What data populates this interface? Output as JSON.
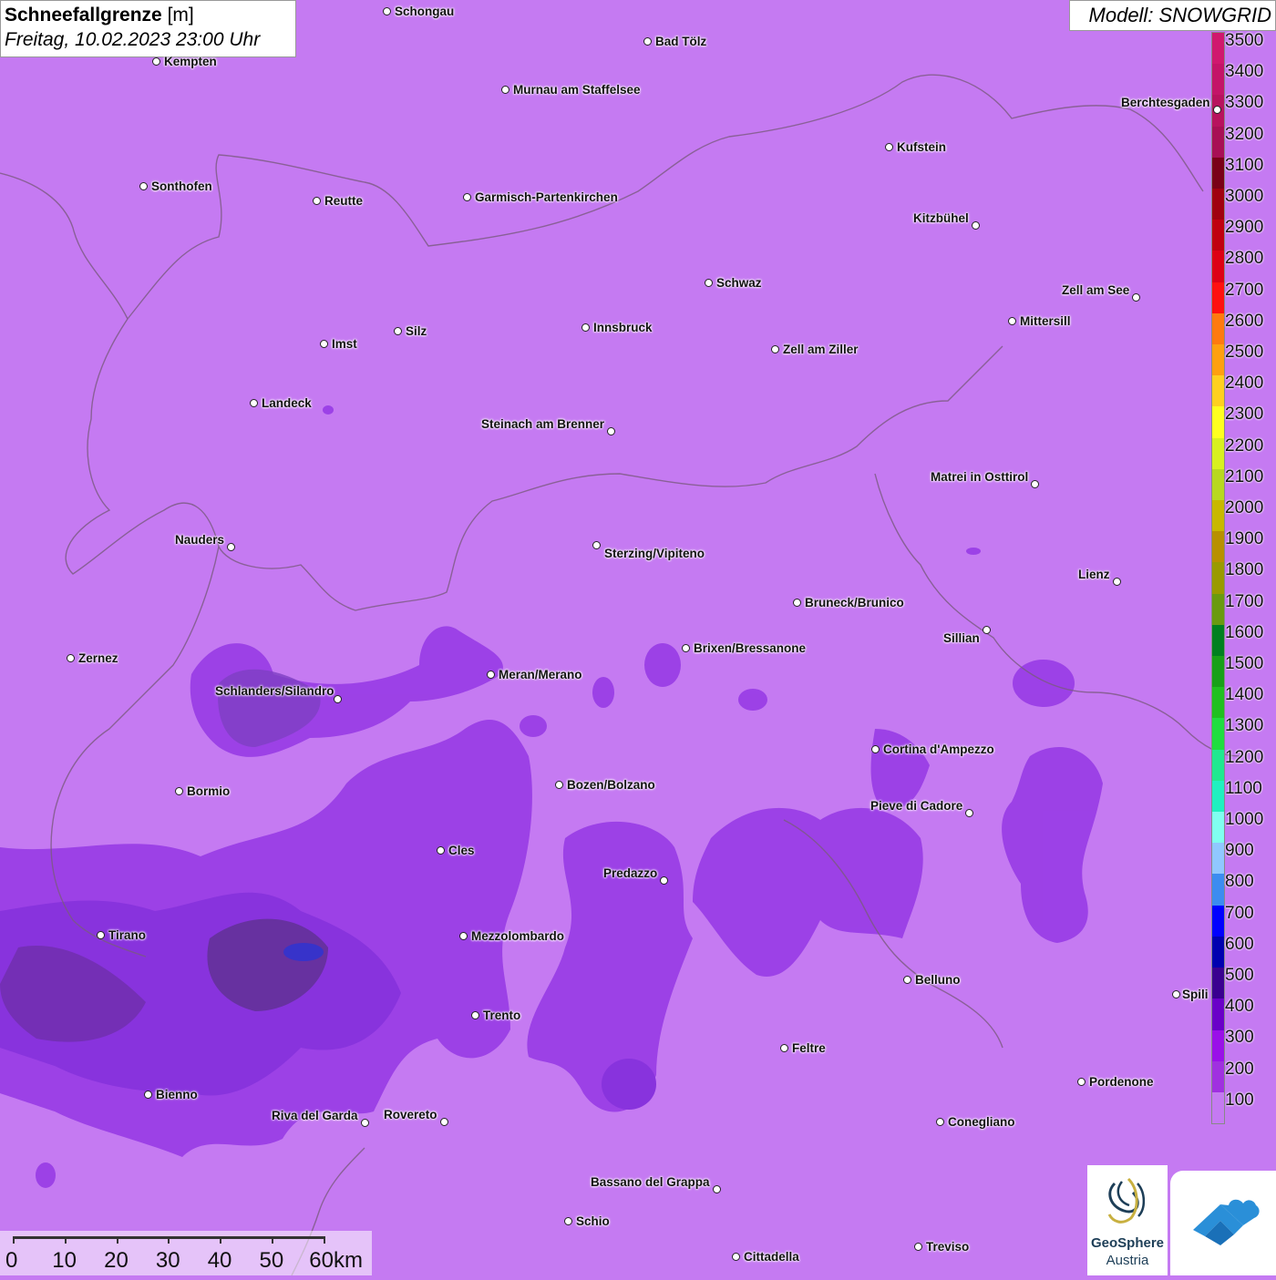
{
  "title": {
    "main": "Schneefallgrenze",
    "unit": "[m]",
    "datetime": "Freitag, 10.02.2023 23:00 Uhr"
  },
  "model": "Modell: SNOWGRID",
  "legend": {
    "labels": [
      "3500",
      "3400",
      "3300",
      "3200",
      "3100",
      "3000",
      "2900",
      "2800",
      "2700",
      "2600",
      "2500",
      "2400",
      "2300",
      "2200",
      "2100",
      "2000",
      "1900",
      "1800",
      "1700",
      "1600",
      "1500",
      "1400",
      "1300",
      "1200",
      "1100",
      "1000",
      "900",
      "800",
      "700",
      "600",
      "500",
      "400",
      "300",
      "200",
      "100"
    ],
    "colors": [
      "#d0186e",
      "#c41468",
      "#b8125e",
      "#a80f55",
      "#7a0018",
      "#a00010",
      "#c00010",
      "#dd0015",
      "#ff1010",
      "#ff7a10",
      "#ffa010",
      "#ffd020",
      "#ffff20",
      "#d8f020",
      "#b8d820",
      "#c8b800",
      "#b89000",
      "#9a9a00",
      "#6a9a10",
      "#008020",
      "#18a018",
      "#20c020",
      "#20dd40",
      "#20e890",
      "#20f0c0",
      "#80fff0",
      "#90c8ff",
      "#3c8cf0",
      "#0000ff",
      "#0000b0",
      "#3a0090",
      "#6a00c8",
      "#9a10e8",
      "#a030e0",
      "#c57af2"
    ]
  },
  "cities": [
    {
      "name": "Schongau"
    },
    {
      "name": "Bad Tölz"
    },
    {
      "name": "Kempten"
    },
    {
      "name": "Murnau am Staffelsee"
    },
    {
      "name": "Berchtesgaden"
    },
    {
      "name": "Kufstein"
    },
    {
      "name": "Sonthofen"
    },
    {
      "name": "Reutte"
    },
    {
      "name": "Garmisch-Partenkirchen"
    },
    {
      "name": "Kitzbühel"
    },
    {
      "name": "Schwaz"
    },
    {
      "name": "Zell am See"
    },
    {
      "name": "Innsbruck"
    },
    {
      "name": "Mittersill"
    },
    {
      "name": "Imst"
    },
    {
      "name": "Silz"
    },
    {
      "name": "Zell am Ziller"
    },
    {
      "name": "Landeck"
    },
    {
      "name": "Steinach am Brenner"
    },
    {
      "name": "Matrei in Osttirol"
    },
    {
      "name": "Nauders"
    },
    {
      "name": "Sterzing/Vipiteno"
    },
    {
      "name": "Lienz"
    },
    {
      "name": "Bruneck/Brunico"
    },
    {
      "name": "Sillian"
    },
    {
      "name": "Zernez"
    },
    {
      "name": "Brixen/Bressanone"
    },
    {
      "name": "Meran/Merano"
    },
    {
      "name": "Schlanders/Silandro"
    },
    {
      "name": "Cortina d'Ampezzo"
    },
    {
      "name": "Bozen/Bolzano"
    },
    {
      "name": "Bormio"
    },
    {
      "name": "Pieve di Cadore"
    },
    {
      "name": "Cles"
    },
    {
      "name": "Predazzo"
    },
    {
      "name": "Tirano"
    },
    {
      "name": "Mezzolombardo"
    },
    {
      "name": "Belluno"
    },
    {
      "name": "Spili"
    },
    {
      "name": "Trento"
    },
    {
      "name": "Feltre"
    },
    {
      "name": "Pordenone"
    },
    {
      "name": "Bienno"
    },
    {
      "name": "Riva del Garda"
    },
    {
      "name": "Rovereto"
    },
    {
      "name": "Conegliano"
    },
    {
      "name": "Bassano del Grappa"
    },
    {
      "name": "Schio"
    },
    {
      "name": "Treviso"
    },
    {
      "name": "Cittadella"
    }
  ],
  "scale": {
    "labels": [
      "0",
      "10",
      "20",
      "30",
      "40",
      "50",
      "60km"
    ]
  },
  "logos": {
    "geosphere_line1": "GeoSphere",
    "geosphere_line2": "Austria"
  }
}
